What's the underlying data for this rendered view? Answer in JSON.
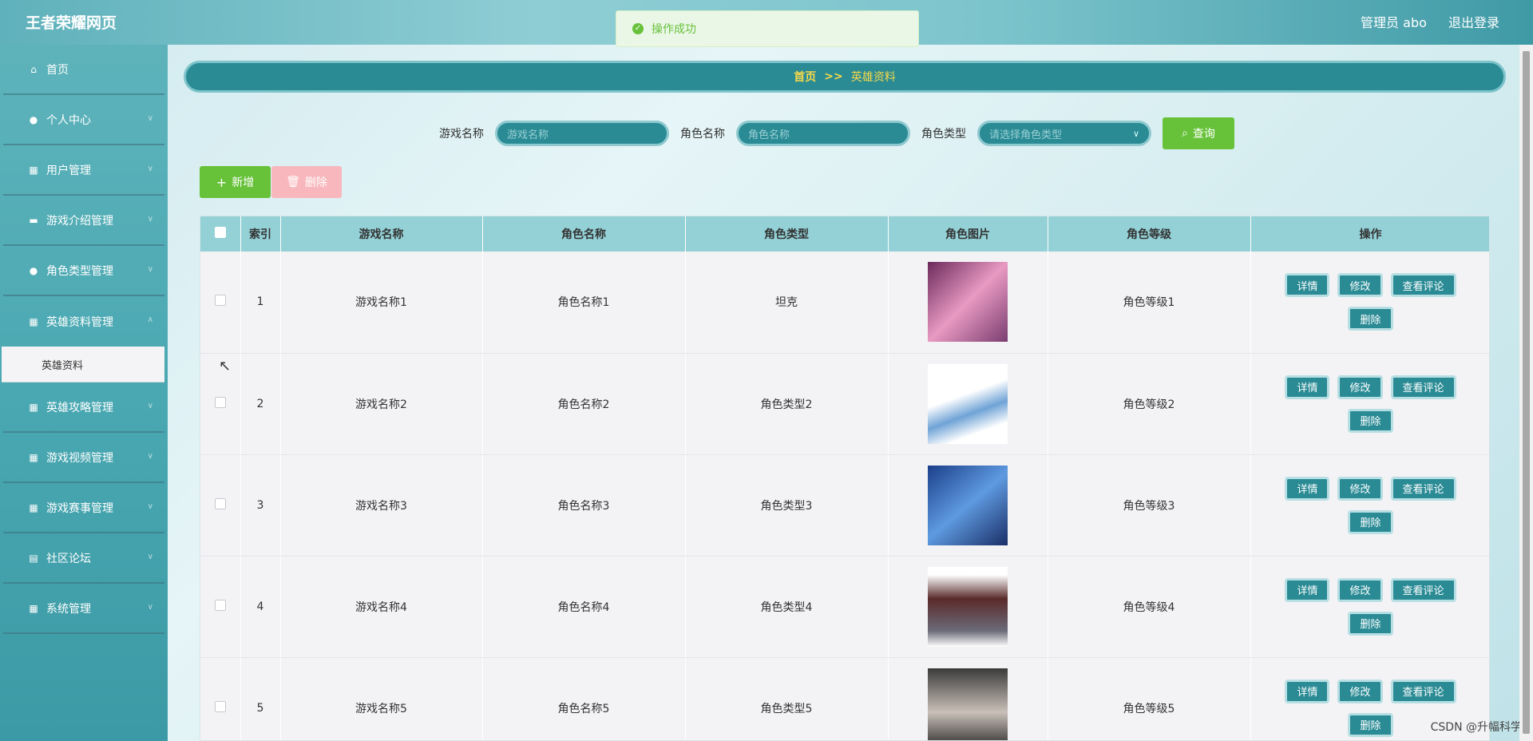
{
  "app": {
    "title": "王者荣耀网页"
  },
  "header": {
    "user_label": "管理员 abo",
    "logout_label": "退出登录"
  },
  "toast": {
    "message": "操作成功",
    "color": "#67c23a"
  },
  "sidebar": {
    "items": [
      {
        "label": "首页",
        "icon": "home-icon",
        "has_children": false
      },
      {
        "label": "个人中心",
        "icon": "user-icon",
        "has_children": true
      },
      {
        "label": "用户管理",
        "icon": "grid-icon",
        "has_children": true
      },
      {
        "label": "游戏介绍管理",
        "icon": "chat-icon",
        "has_children": true
      },
      {
        "label": "角色类型管理",
        "icon": "user-icon",
        "has_children": true
      },
      {
        "label": "英雄资料管理",
        "icon": "grid-icon",
        "has_children": true,
        "expanded": true,
        "children": [
          "英雄资料"
        ]
      },
      {
        "label": "英雄攻略管理",
        "icon": "grid-icon",
        "has_children": true
      },
      {
        "label": "游戏视频管理",
        "icon": "grid-icon",
        "has_children": true
      },
      {
        "label": "游戏赛事管理",
        "icon": "grid-icon",
        "has_children": true
      },
      {
        "label": "社区论坛",
        "icon": "forum-icon",
        "has_children": true
      },
      {
        "label": "系统管理",
        "icon": "grid-icon",
        "has_children": true
      }
    ]
  },
  "breadcrumb": {
    "home": "首页",
    "separator": ">>",
    "current": "英雄资料"
  },
  "search": {
    "game_name_label": "游戏名称",
    "game_name_placeholder": "游戏名称",
    "role_name_label": "角色名称",
    "role_name_placeholder": "角色名称",
    "role_type_label": "角色类型",
    "role_type_placeholder": "请选择角色类型",
    "query_label": "查询"
  },
  "actions": {
    "add_label": "新增",
    "delete_label": "删除"
  },
  "table": {
    "columns": [
      "索引",
      "游戏名称",
      "角色名称",
      "角色类型",
      "角色图片",
      "角色等级",
      "操作"
    ],
    "rows": [
      {
        "index": "1",
        "game_name": "游戏名称1",
        "role_name": "角色名称1",
        "role_type": "坦克",
        "role_level": "角色等级1"
      },
      {
        "index": "2",
        "game_name": "游戏名称2",
        "role_name": "角色名称2",
        "role_type": "角色类型2",
        "role_level": "角色等级2"
      },
      {
        "index": "3",
        "game_name": "游戏名称3",
        "role_name": "角色名称3",
        "role_type": "角色类型3",
        "role_level": "角色等级3"
      },
      {
        "index": "4",
        "game_name": "游戏名称4",
        "role_name": "角色名称4",
        "role_type": "角色类型4",
        "role_level": "角色等级4"
      },
      {
        "index": "5",
        "game_name": "游戏名称5",
        "role_name": "角色名称5",
        "role_type": "角色类型5",
        "role_level": "角色等级5"
      }
    ],
    "row_ops": {
      "detail": "详情",
      "edit": "修改",
      "comments": "查看评论",
      "delete": "删除"
    }
  },
  "watermark": "CSDN @升幅科学"
}
